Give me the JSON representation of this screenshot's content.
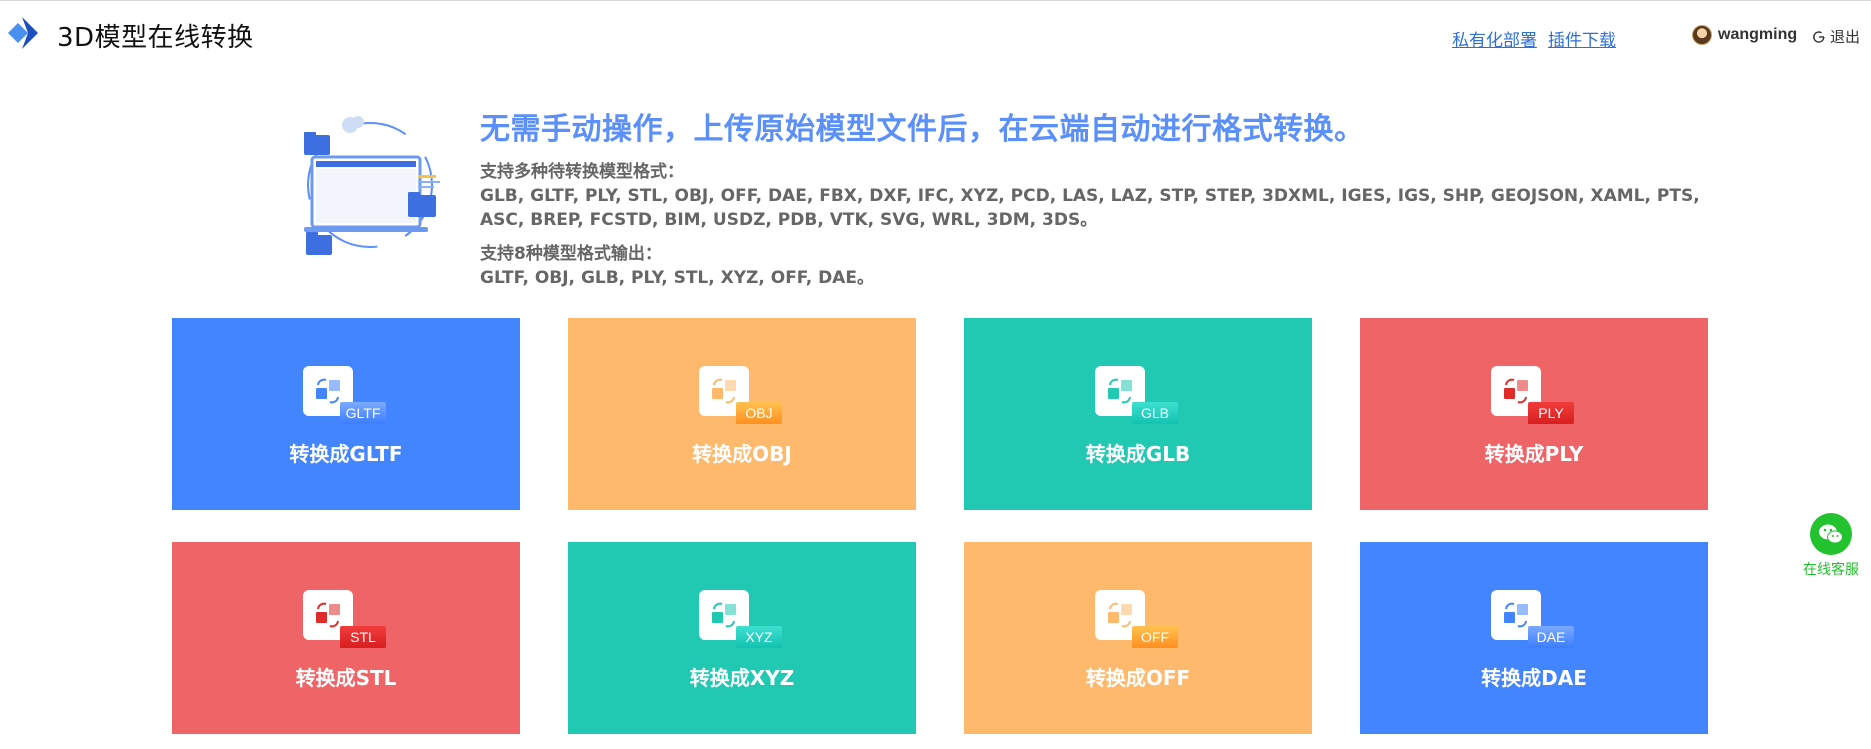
{
  "header": {
    "title": "3D模型在线转换",
    "links": {
      "private": "私有化部署",
      "plugin": "插件下载"
    },
    "user": "wangming",
    "logout": "退出"
  },
  "intro": {
    "headline": "无需手动操作，上传原始模型文件后，在云端自动进行格式转换。",
    "input_label": "支持多种待转换模型格式：",
    "input_formats": "GLB, GLTF, PLY, STL, OBJ, OFF, DAE, FBX, DXF, IFC, XYZ, PCD, LAS, LAZ, STP, STEP, 3DXML, IGES, IGS, SHP, GEOJSON, XAML, PTS, ASC, BREP, FCSTD, BIM, USDZ, PDB, VTK, SVG, WRL, 3DM, 3DS。",
    "output_label": "支持8种模型格式输出：",
    "output_formats": "GLTF, OBJ, GLB, PLY, STL, XYZ, OFF, DAE。"
  },
  "cards": [
    {
      "tag": "GLTF",
      "label": "转换成GLTF",
      "color": "#4384ff"
    },
    {
      "tag": "OBJ",
      "label": "转换成OBJ",
      "color": "#ffb96d"
    },
    {
      "tag": "GLB",
      "label": "转换成GLB",
      "color": "#21c9b3"
    },
    {
      "tag": "PLY",
      "label": "转换成PLY",
      "color": "#ef6466"
    },
    {
      "tag": "STL",
      "label": "转换成STL",
      "color": "#ef6466"
    },
    {
      "tag": "XYZ",
      "label": "转换成XYZ",
      "color": "#21c9b3"
    },
    {
      "tag": "OFF",
      "label": "转换成OFF",
      "color": "#ffb96d"
    },
    {
      "tag": "DAE",
      "label": "转换成DAE",
      "color": "#4384ff"
    }
  ],
  "service": {
    "label": "在线客服",
    "icon": "wechat-icon"
  }
}
